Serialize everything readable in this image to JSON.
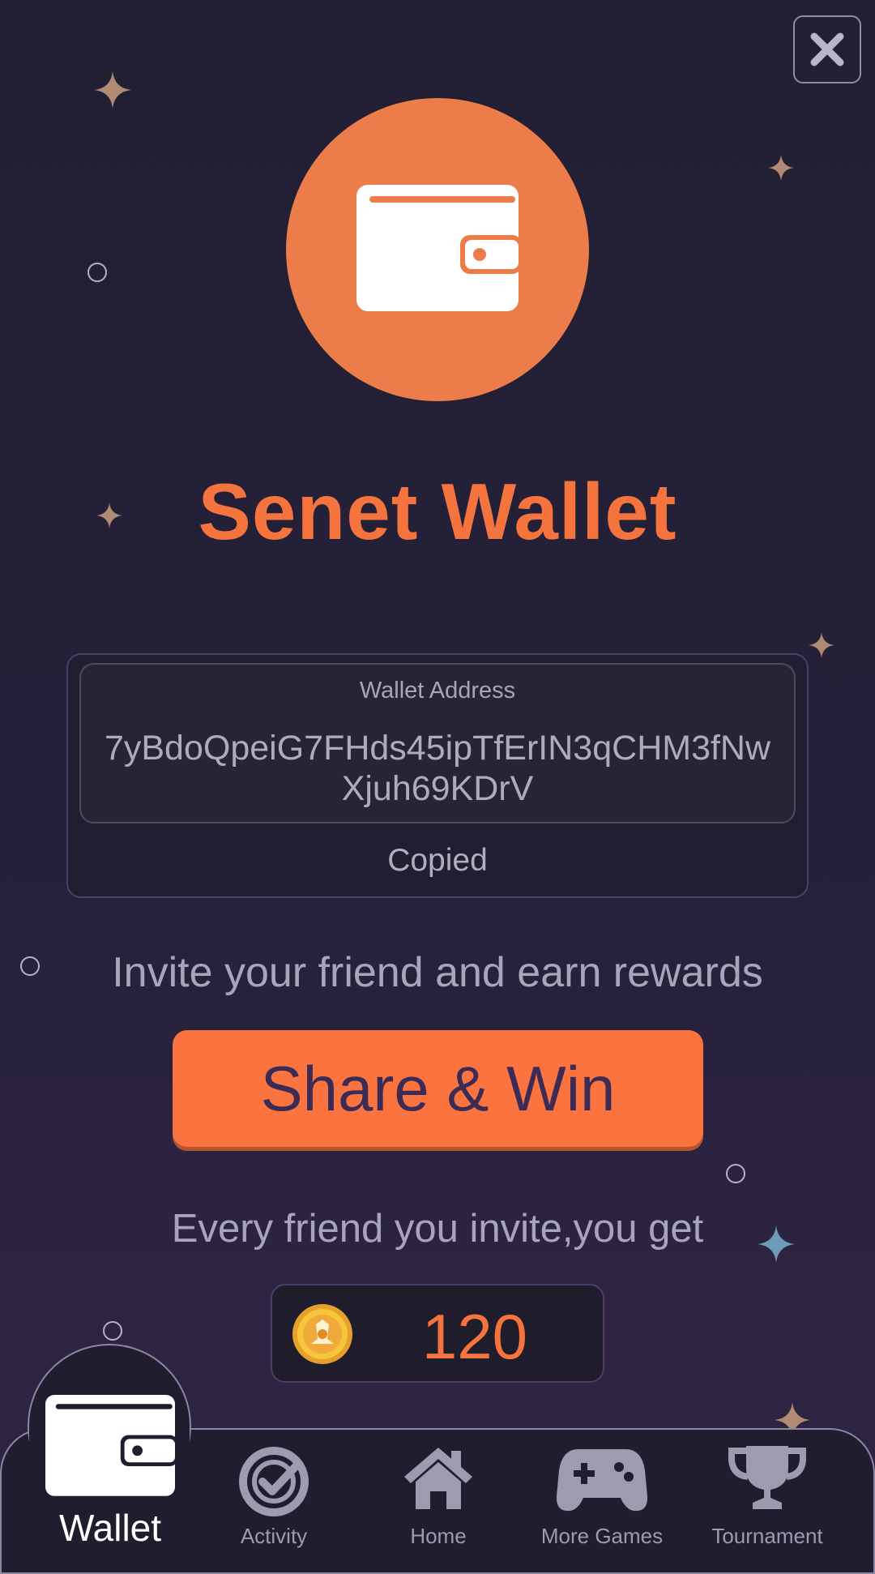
{
  "app": {
    "title": "Senet Wallet",
    "accent": "#f5743e",
    "circle_color": "#ec7d4a"
  },
  "header": {
    "close_icon": "close-icon"
  },
  "wallet": {
    "address_label": "Wallet Address",
    "address": "7yBdoQpeiG7FHds45ipTfErIN3qCHM3fNwXjuh69KDrV",
    "copy_status": "Copied"
  },
  "invite": {
    "text": "Invite your friend and earn rewards",
    "button_label": "Share & Win",
    "reward_text": "Every friend you invite,you get",
    "reward_amount": "120",
    "reward_icon": "coin-icon"
  },
  "nav": {
    "items": [
      {
        "label": "Wallet",
        "icon": "wallet-icon",
        "active": true
      },
      {
        "label": "Activity",
        "icon": "check-circle-icon",
        "active": false
      },
      {
        "label": "Home",
        "icon": "home-icon",
        "active": false
      },
      {
        "label": "More Games",
        "icon": "gamepad-icon",
        "active": false
      },
      {
        "label": "Tournament",
        "icon": "trophy-icon",
        "active": false
      }
    ]
  }
}
